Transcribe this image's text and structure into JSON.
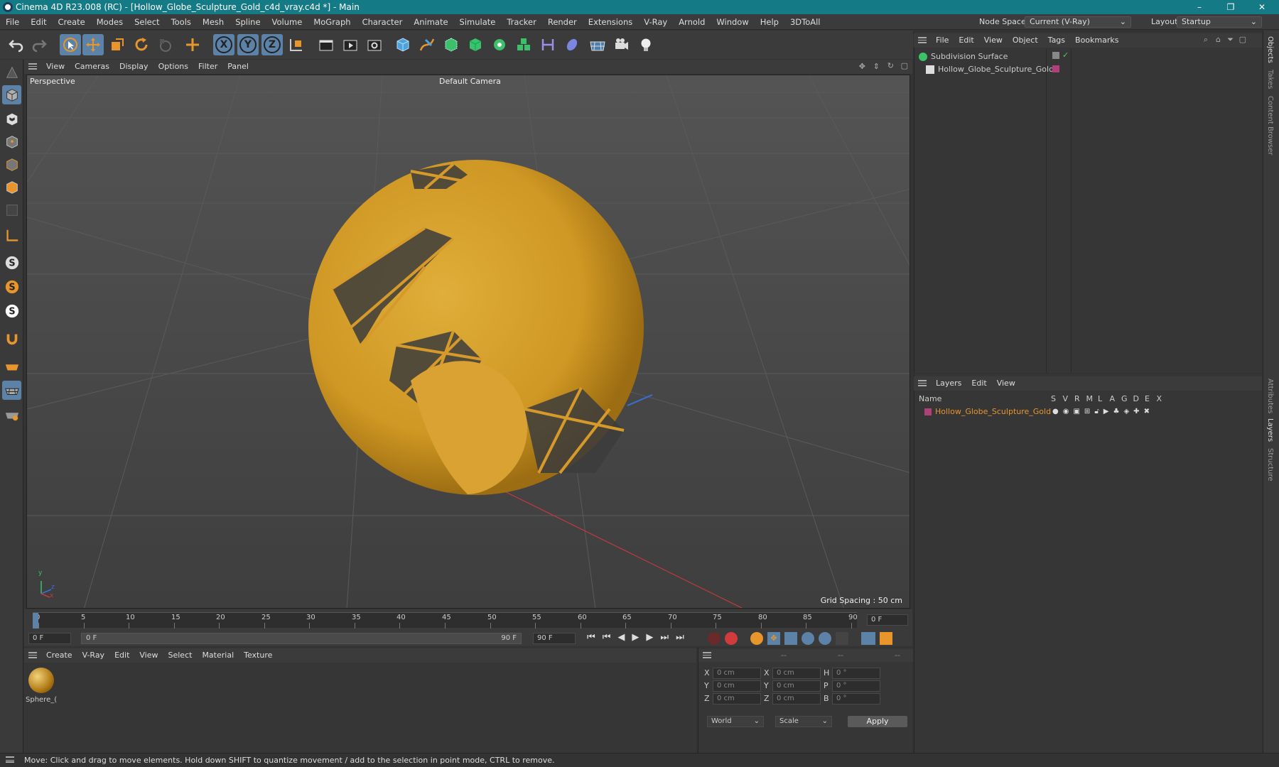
{
  "window": {
    "title": "Cinema 4D R23.008 (RC) - [Hollow_Globe_Sculpture_Gold_c4d_vray.c4d *] - Main",
    "controls": [
      "–",
      "❐",
      "✕"
    ]
  },
  "menubar": {
    "items": [
      "File",
      "Edit",
      "Create",
      "Modes",
      "Select",
      "Tools",
      "Mesh",
      "Spline",
      "Volume",
      "MoGraph",
      "Character",
      "Animate",
      "Simulate",
      "Tracker",
      "Render",
      "Extensions",
      "V-Ray",
      "Arnold",
      "Window",
      "Help",
      "3DToAll"
    ],
    "node_space_label": "Node Space:",
    "node_space_value": "Current (V-Ray)",
    "layout_label": "Layout:",
    "layout_value": "Startup"
  },
  "toolbar": {
    "axis_x": "X",
    "axis_y": "Y",
    "axis_z": "Z"
  },
  "viewport": {
    "menu": [
      "View",
      "Cameras",
      "Display",
      "Options",
      "Filter",
      "Panel"
    ],
    "view_name": "Perspective",
    "camera": "Default Camera",
    "grid_spacing": "Grid Spacing : 50 cm",
    "axis_y": "y",
    "axis_z": "z",
    "axis_x": "x"
  },
  "timeline": {
    "ticks": [
      "0",
      "5",
      "10",
      "15",
      "20",
      "25",
      "30",
      "35",
      "40",
      "45",
      "50",
      "55",
      "60",
      "65",
      "70",
      "75",
      "80",
      "85",
      "90"
    ],
    "current_frame": "0 F"
  },
  "transport": {
    "start": "0 F",
    "range_start": "0 F",
    "range_end": "90 F",
    "end": "90 F"
  },
  "material_manager": {
    "menu": [
      "Create",
      "V-Ray",
      "Edit",
      "View",
      "Select",
      "Material",
      "Texture"
    ],
    "materials": [
      {
        "name": "Sphere_("
      }
    ]
  },
  "coordinates": {
    "headers": [
      "--",
      "--",
      "--"
    ],
    "rows": [
      {
        "a": "X",
        "av": "0 cm",
        "b": "X",
        "bv": "0 cm",
        "c": "H",
        "cv": "0 °"
      },
      {
        "a": "Y",
        "av": "0 cm",
        "b": "Y",
        "bv": "0 cm",
        "c": "P",
        "cv": "0 °"
      },
      {
        "a": "Z",
        "av": "0 cm",
        "b": "Z",
        "bv": "0 cm",
        "c": "B",
        "cv": "0 °"
      }
    ],
    "mode": "World",
    "size_mode": "Scale",
    "apply": "Apply"
  },
  "object_manager": {
    "menu": [
      "File",
      "Edit",
      "View",
      "Object",
      "Tags",
      "Bookmarks"
    ],
    "objects": [
      {
        "name": "Subdivision Surface"
      },
      {
        "name": "Hollow_Globe_Sculpture_Gold"
      }
    ]
  },
  "layer_manager": {
    "menu": [
      "Layers",
      "Edit",
      "View"
    ],
    "columns": [
      "Name",
      "S",
      "V",
      "R",
      "M",
      "L",
      "A",
      "G",
      "D",
      "E",
      "X"
    ],
    "layers": [
      {
        "name": "Hollow_Globe_Sculpture_Gold",
        "color": "#b0407a"
      }
    ]
  },
  "side_tabs": [
    "Objects",
    "Takes",
    "Content Browser",
    "Attributes",
    "Layers",
    "Structure"
  ],
  "status": "Move: Click and drag to move elements. Hold down SHIFT to quantize movement / add to the selection in point mode, CTRL to remove.",
  "colors": {
    "accent": "#5d82a8",
    "gold": "#d69a2a",
    "title_bar": "#147b86",
    "layer_text": "#e8952c"
  }
}
